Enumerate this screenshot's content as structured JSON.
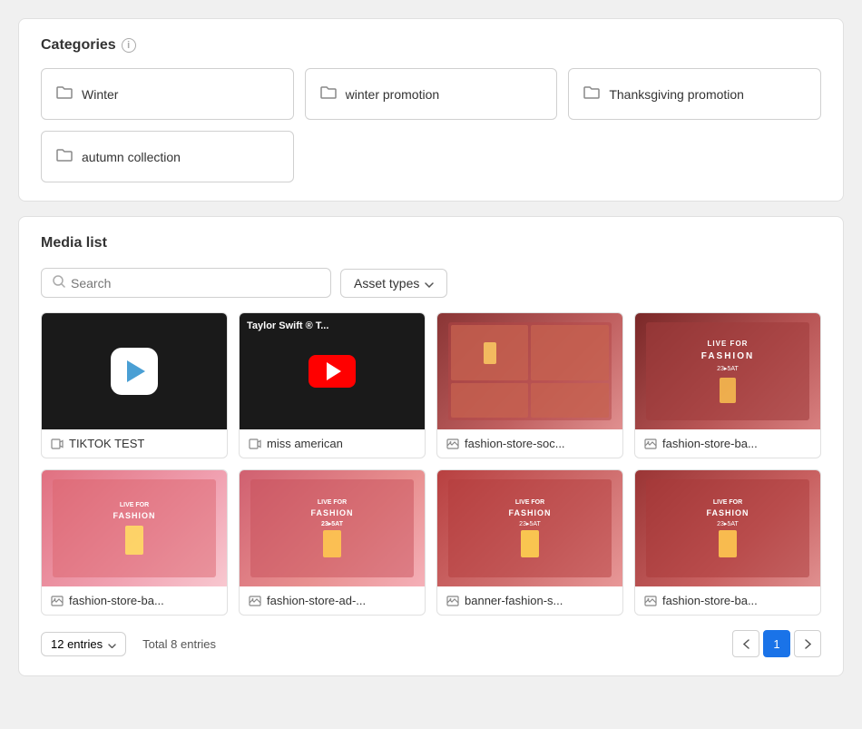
{
  "categories": {
    "title": "Categories",
    "info_icon": "ⓘ",
    "items": [
      {
        "id": "winter",
        "label": "Winter"
      },
      {
        "id": "winter-promotion",
        "label": "winter promotion"
      },
      {
        "id": "thanksgiving",
        "label": "Thanksgiving promotion"
      },
      {
        "id": "autumn",
        "label": "autumn collection"
      }
    ]
  },
  "media_list": {
    "title": "Media list",
    "search": {
      "placeholder": "Search"
    },
    "asset_types_btn": "Asset types",
    "items": [
      {
        "id": "tiktok",
        "name": "TIKTOK TEST",
        "type": "video",
        "thumb": "black"
      },
      {
        "id": "miss-american",
        "name": "miss american",
        "type": "video",
        "thumb": "youtube"
      },
      {
        "id": "fashion-soc",
        "name": "fashion-store-soc...",
        "type": "image",
        "thumb": "fashion-grid"
      },
      {
        "id": "fashion-ba-1",
        "name": "fashion-store-ba...",
        "type": "image",
        "thumb": "fashion-single-1"
      },
      {
        "id": "fashion-ba-2",
        "name": "fashion-store-ba...",
        "type": "image",
        "thumb": "fashion-pink"
      },
      {
        "id": "fashion-ad",
        "name": "fashion-store-ad-...",
        "type": "image",
        "thumb": "fashion-single-2"
      },
      {
        "id": "banner-fashion",
        "name": "banner-fashion-s...",
        "type": "image",
        "thumb": "fashion-single-3"
      },
      {
        "id": "fashion-ba-3",
        "name": "fashion-store-ba...",
        "type": "image",
        "thumb": "fashion-single-4"
      }
    ],
    "pagination": {
      "entries_per_page": "12 entries",
      "total": "Total 8 entries",
      "current_page": 1,
      "total_pages": 1
    }
  }
}
